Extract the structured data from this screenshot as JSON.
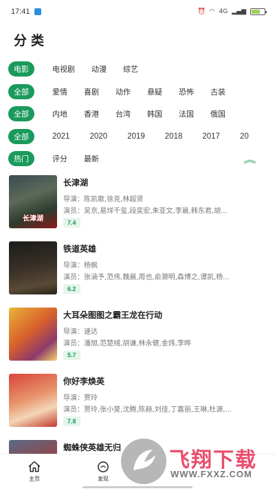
{
  "status": {
    "time": "17:41",
    "network": "4G"
  },
  "title": "分类",
  "filters": {
    "type": [
      "电影",
      "电视剧",
      "动漫",
      "综艺"
    ],
    "genre": [
      "全部",
      "爱情",
      "喜剧",
      "动作",
      "悬疑",
      "恐怖",
      "古装"
    ],
    "region": [
      "全部",
      "内地",
      "香港",
      "台湾",
      "韩国",
      "法国",
      "俄国"
    ],
    "year": [
      "全部",
      "2021",
      "2020",
      "2019",
      "2018",
      "2017",
      "20"
    ],
    "sort": [
      "热门",
      "评分",
      "最新"
    ],
    "collapse_icon": "︽"
  },
  "movies": [
    {
      "title": "长津湖",
      "director": "导演：陈凯歌,徐克,林超贤",
      "actors": "演员：吴京,易烊千玺,段奕宏,朱亚文,李晨,韩东君,胡...",
      "score": "7.4",
      "poster_text": "长津湖"
    },
    {
      "title": "铁道英雄",
      "director": "导演：杨枫",
      "actors": "演员：张涵予,范伟,魏晨,周也,俞灏明,森博之,谭凯,杨...",
      "score": "6.2",
      "poster_text": ""
    },
    {
      "title": "大耳朵图图之霸王龙在行动",
      "director": "导演：速达",
      "actors": "演员：潘旭,范楚绒,胡谦,林永健,金炜,李晔",
      "score": "5.7",
      "poster_text": ""
    },
    {
      "title": "你好李焕英",
      "director": "导演：贾玲",
      "actors": "演员：贾玲,张小斐,沈腾,陈赫,刘佳,丁嘉丽,王琳,杜源,...",
      "score": "7.8",
      "poster_text": ""
    },
    {
      "title": "蜘蛛侠英雄无归",
      "director": "",
      "actors": "",
      "score": "",
      "poster_text": ""
    }
  ],
  "nav": [
    {
      "label": "主页",
      "icon": "home-icon"
    },
    {
      "label": "发现",
      "icon": "discover-icon"
    },
    {
      "label": "",
      "icon": ""
    },
    {
      "label": "",
      "icon": ""
    }
  ],
  "watermark": {
    "text": "飞翔下载",
    "url": "WWW.FXXZ.COM"
  },
  "colors": {
    "accent": "#1a9a5b",
    "watermark": "#e94e6c"
  }
}
